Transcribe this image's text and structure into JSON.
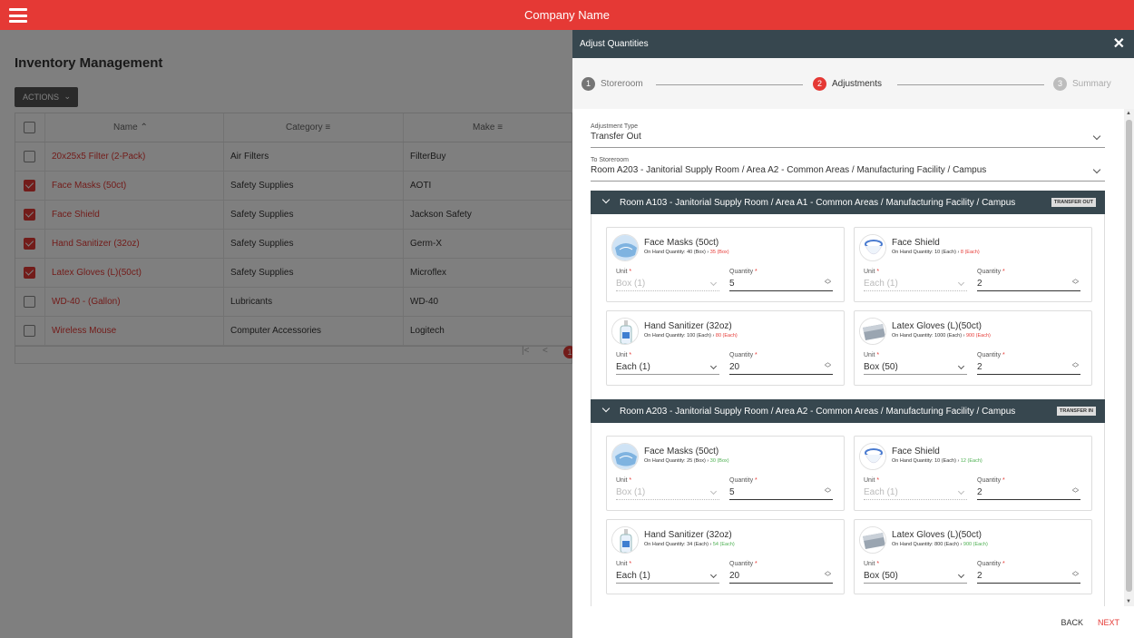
{
  "app": {
    "title": "Company Name"
  },
  "page": {
    "title": "Inventory Management",
    "actions_label": "ACTIONS"
  },
  "table": {
    "headers": {
      "name": "Name",
      "category": "Category",
      "make": "Make"
    },
    "rows": [
      {
        "name": "20x25x5 Filter (2-Pack)",
        "category": "Air Filters",
        "make": "FilterBuy",
        "checked": false
      },
      {
        "name": "Face Masks (50ct)",
        "category": "Safety Supplies",
        "make": "AOTI",
        "checked": true
      },
      {
        "name": "Face Shield",
        "category": "Safety Supplies",
        "make": "Jackson Safety",
        "checked": true
      },
      {
        "name": "Hand Sanitizer (32oz)",
        "category": "Safety Supplies",
        "make": "Germ-X",
        "checked": true
      },
      {
        "name": "Latex Gloves (L)(50ct)",
        "category": "Safety Supplies",
        "make": "Microflex",
        "checked": true
      },
      {
        "name": "WD-40 - (Gallon)",
        "category": "Lubricants",
        "make": "WD-40",
        "checked": false
      },
      {
        "name": "Wireless Mouse",
        "category": "Computer Accessories",
        "make": "Logitech",
        "checked": false
      }
    ],
    "current_page": "1"
  },
  "panel": {
    "title": "Adjust Quantities",
    "close_glyph": "✕",
    "steps": [
      {
        "num": "1",
        "label": "Storeroom"
      },
      {
        "num": "2",
        "label": "Adjustments"
      },
      {
        "num": "3",
        "label": "Summary"
      }
    ],
    "adjustment_type": {
      "label": "Adjustment Type",
      "value": "Transfer Out"
    },
    "to_storeroom": {
      "label": "To Storeroom",
      "value": "Room A203 - Janitorial Supply Room / Area A2 - Common Areas / Manufacturing Facility / Campus"
    },
    "unit_label": "Unit",
    "qty_label": "Quantity",
    "required_mark": "*",
    "groups": [
      {
        "title": "Room A103 - Janitorial Supply Room / Area A1 - Common Areas / Manufacturing Facility / Campus",
        "badge": "TRANSFER OUT",
        "items": [
          {
            "name": "Face Masks (50ct)",
            "onhand_label": "On Hand Quantity:",
            "from": "40 (Box)",
            "to": "35 (Box)",
            "unit": "Box (1)",
            "unit_disabled": true,
            "qty": "5"
          },
          {
            "name": "Face Shield",
            "onhand_label": "On Hand Quantity:",
            "from": "10 (Each)",
            "to": "8 (Each)",
            "unit": "Each (1)",
            "unit_disabled": true,
            "qty": "2"
          },
          {
            "name": "Hand Sanitizer (32oz)",
            "onhand_label": "On Hand Quantity:",
            "from": "100 (Each)",
            "to": "80 (Each)",
            "unit": "Each (1)",
            "unit_disabled": false,
            "qty": "20"
          },
          {
            "name": "Latex Gloves (L)(50ct)",
            "onhand_label": "On Hand Quantity:",
            "from": "1000 (Each)",
            "to": "900 (Each)",
            "unit": "Box (50)",
            "unit_disabled": false,
            "qty": "2"
          }
        ]
      },
      {
        "title": "Room A203 - Janitorial Supply Room / Area A2 - Common Areas / Manufacturing Facility / Campus",
        "badge": "TRANSFER IN",
        "items": [
          {
            "name": "Face Masks (50ct)",
            "onhand_label": "On Hand Quantity:",
            "from": "25 (Box)",
            "to": "30 (Box)",
            "unit": "Box (1)",
            "unit_disabled": true,
            "qty": "5"
          },
          {
            "name": "Face Shield",
            "onhand_label": "On Hand Quantity:",
            "from": "10 (Each)",
            "to": "12 (Each)",
            "unit": "Each (1)",
            "unit_disabled": true,
            "qty": "2"
          },
          {
            "name": "Hand Sanitizer (32oz)",
            "onhand_label": "On Hand Quantity:",
            "from": "34 (Each)",
            "to": "54 (Each)",
            "unit": "Each (1)",
            "unit_disabled": false,
            "qty": "20"
          },
          {
            "name": "Latex Gloves (L)(50ct)",
            "onhand_label": "On Hand Quantity:",
            "from": "800 (Each)",
            "to": "900 (Each)",
            "unit": "Box (50)",
            "unit_disabled": false,
            "qty": "2"
          }
        ]
      }
    ],
    "back_label": "BACK",
    "next_label": "NEXT"
  },
  "colors": {
    "brand": "#e53935",
    "header_dark": "#37474f",
    "increase": "#4caf50",
    "decrease": "#e53935"
  }
}
